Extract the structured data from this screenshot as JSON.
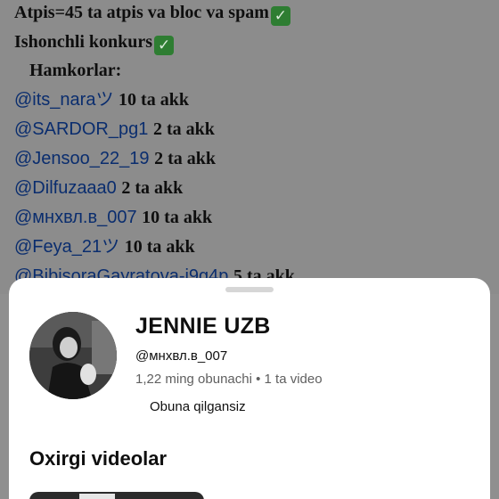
{
  "post": {
    "line1_text": "Atpis=45 ta atpis va bloc va spam",
    "line1_icon": "check-mark-icon",
    "line2_text": "Ishonchli konkurs",
    "line2_icon": "check-mark-icon",
    "partners_heading": "Hamkorlar:",
    "partners": [
      {
        "handle": "@its_naraツ",
        "count": "10 ta  akk"
      },
      {
        "handle": "@SARDOR_pg1",
        "count": "2 ta akk"
      },
      {
        "handle": "@Jensoo_22_19",
        "count": "2 ta akk"
      },
      {
        "handle": "@Dilfuzaaa0",
        "count": "2 ta akk"
      },
      {
        "handle": "@мнхвл.в_007",
        "count": "10 ta akk"
      },
      {
        "handle": "@Feya_21ツ",
        "count": "10 ta akk"
      },
      {
        "handle": "@BibisoraGayratova-i9g4p",
        "count": "5 ta akk"
      }
    ]
  },
  "sheet": {
    "channel_name": "JENNIE UZB",
    "channel_handle": "@мнхвл.в_007",
    "stats": "1,22 ming obunachi • 1 ta video",
    "subscribe_label": "Obuna qilgansiz",
    "recent_videos_title": "Oxirgi videolar"
  },
  "colors": {
    "overlay_background": "#8c8c8c",
    "mention_link": "#0a2d6e",
    "check_badge": "#2e7d32",
    "sheet_background": "#ffffff",
    "secondary_text": "#606060"
  }
}
